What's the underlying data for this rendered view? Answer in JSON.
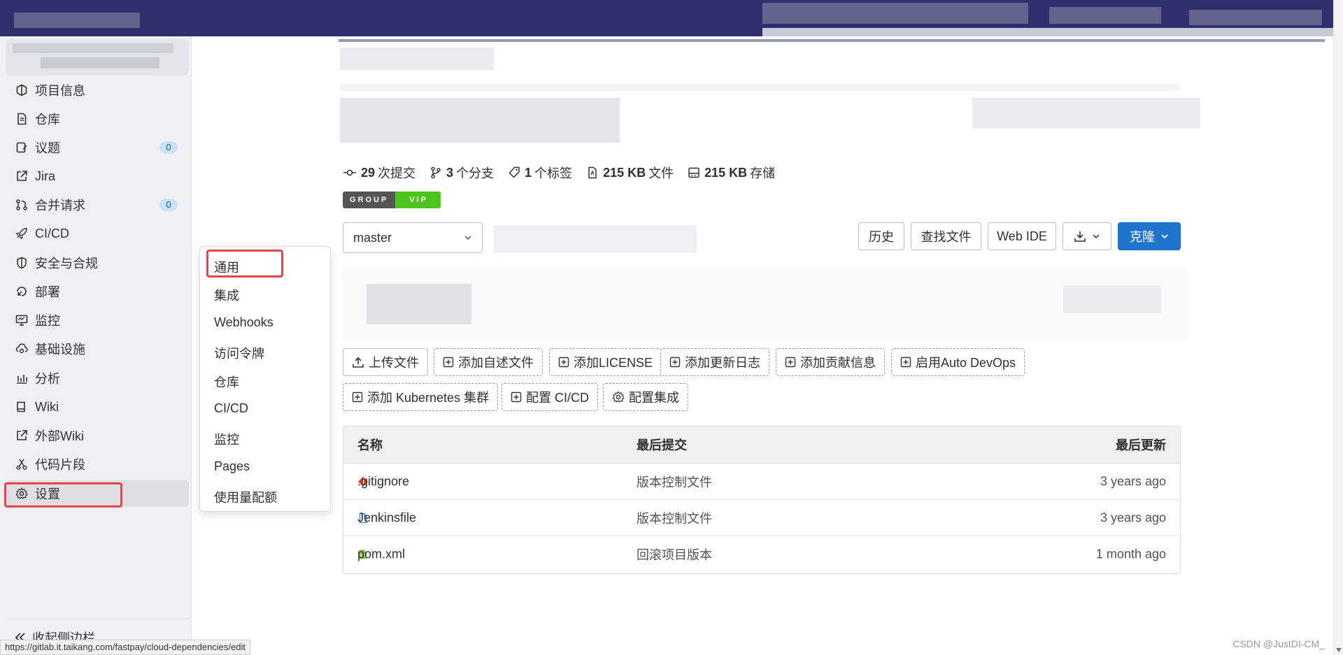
{
  "sidebar": {
    "items": [
      {
        "label": "项目信息",
        "icon": "project-icon"
      },
      {
        "label": "仓库",
        "icon": "repository-icon"
      },
      {
        "label": "议题",
        "icon": "issues-icon",
        "badge": "0"
      },
      {
        "label": "Jira",
        "icon": "external-link-icon"
      },
      {
        "label": "合并请求",
        "icon": "merge-request-icon",
        "badge": "0"
      },
      {
        "label": "CI/CD",
        "icon": "rocket-icon"
      },
      {
        "label": "安全与合规",
        "icon": "shield-icon"
      },
      {
        "label": "部署",
        "icon": "deployments-icon"
      },
      {
        "label": "监控",
        "icon": "monitor-icon"
      },
      {
        "label": "基础设施",
        "icon": "cloud-gear-icon"
      },
      {
        "label": "分析",
        "icon": "chart-icon"
      },
      {
        "label": "Wiki",
        "icon": "book-icon"
      },
      {
        "label": "外部Wiki",
        "icon": "external-link-icon"
      },
      {
        "label": "代码片段",
        "icon": "snippet-icon"
      },
      {
        "label": "设置",
        "icon": "gear-icon"
      }
    ],
    "collapse_label": "收起侧边栏"
  },
  "settings_flyout": {
    "items": [
      "通用",
      "集成",
      "Webhooks",
      "访问令牌",
      "仓库",
      "CI/CD",
      "监控",
      "Pages",
      "使用量配额"
    ]
  },
  "stats": {
    "commits_count": "29",
    "commits_label": "次提交",
    "branches_count": "3",
    "branches_label": "个分支",
    "tags_count": "1",
    "tags_label": "个标签",
    "files_size": "215 KB",
    "files_label": "文件",
    "storage_size": "215 KB",
    "storage_label": "存储"
  },
  "badge": {
    "left": "GROUP",
    "right": "VIP"
  },
  "toolbar": {
    "branch": "master",
    "history": "历史",
    "find_file": "查找文件",
    "web_ide": "Web IDE",
    "clone": "克隆"
  },
  "actions": {
    "upload": "上传文件",
    "add_readme": "添加自述文件",
    "add_license": "添加LICENSE",
    "add_changelog": "添加更新日志",
    "add_contributing": "添加贡献信息",
    "auto_devops": "启用Auto DevOps",
    "add_k8s": "添加 Kubernetes 集群",
    "config_ci": "配置 CI/CD",
    "config_integrations": "配置集成"
  },
  "table": {
    "headers": {
      "name": "名称",
      "last_commit": "最后提交",
      "last_update": "最后更新"
    },
    "rows": [
      {
        "name": ".gitignore",
        "commit": "版本控制文件",
        "updated": "3 years ago",
        "icon": "git-icon"
      },
      {
        "name": "Jenkinsfile",
        "commit": "版本控制文件",
        "updated": "3 years ago",
        "icon": "file-icon"
      },
      {
        "name": "pom.xml",
        "commit": "回滚项目版本",
        "updated": "1 month ago",
        "icon": "xml-file-icon"
      }
    ]
  },
  "status_url": "https://gitlab.it.taikang.com/fastpay/cloud-dependencies/edit",
  "watermark": "CSDN @JustDI-CM_",
  "colors": {
    "topbar": "#2f2f6e",
    "primary": "#1f75cb",
    "highlight": "#e0474b",
    "vip_green": "#4bc51d"
  }
}
